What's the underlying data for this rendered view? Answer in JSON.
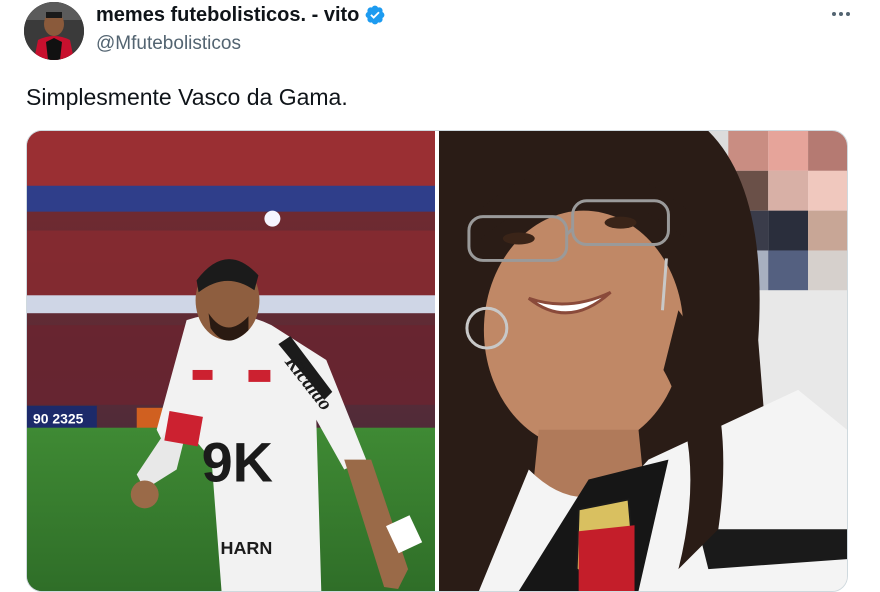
{
  "post": {
    "author_name": "memes futebolisticos. - vito",
    "handle": "@Mfutebolisticos",
    "text": "Simplesmente Vasco da Gama.",
    "verified": true
  },
  "icons": {
    "verified": "verified-badge-icon",
    "more": "more-horizontal-icon"
  },
  "media": {
    "count": 2,
    "left_image": {
      "jersey_sponsor_text": "Kicaldo",
      "jersey_number_text": "9K",
      "jersey_lower_text": "HARN",
      "scoreboard_text": "90 2325"
    },
    "right_image": {}
  },
  "colors": {
    "name_text": "#0f1419",
    "secondary_text": "#536471",
    "verified_blue": "#1d9bf0",
    "border": "#cfd9de"
  }
}
